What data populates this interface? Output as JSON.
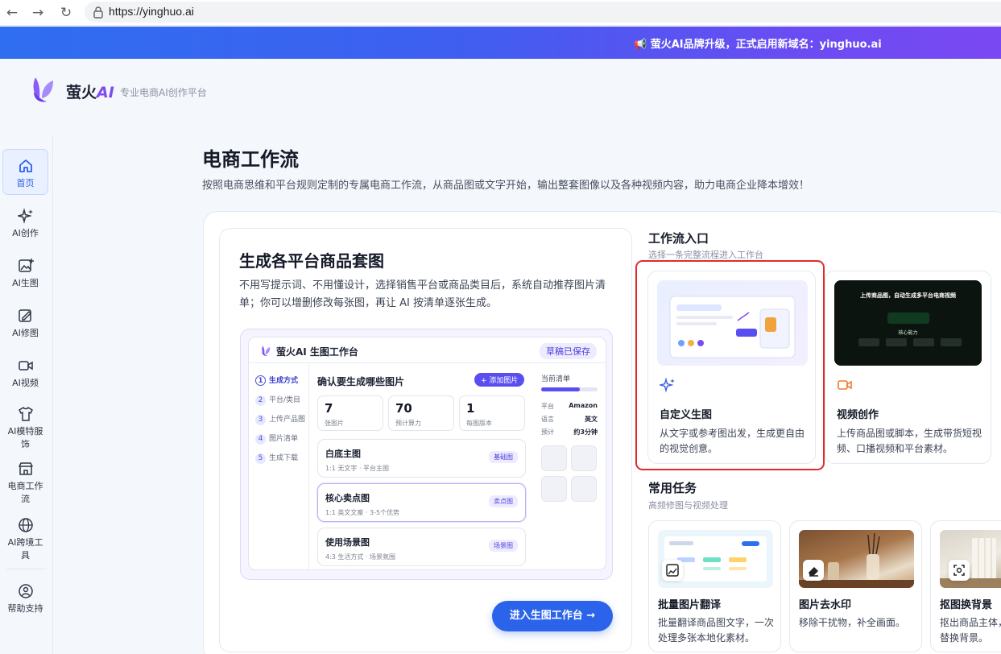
{
  "browser": {
    "url": "https://yinghuo.ai"
  },
  "banner": {
    "text": "📢 萤火AI品牌升级，正式启用新域名：yinghuo.ai"
  },
  "header": {
    "brand_main": "萤火",
    "brand_ai": "AI",
    "slogan": "专业电商AI创作平台"
  },
  "sidebar": {
    "items": [
      {
        "label": "首页",
        "icon": "home-icon"
      },
      {
        "label": "AI创作",
        "icon": "sparkle-icon"
      },
      {
        "label": "AI生图",
        "icon": "image-plus-icon"
      },
      {
        "label": "AI修图",
        "icon": "image-edit-icon"
      },
      {
        "label": "AI视频",
        "icon": "video-icon"
      },
      {
        "label": "AI模特服饰",
        "icon": "tshirt-icon"
      },
      {
        "label": "电商工作流",
        "icon": "store-icon"
      },
      {
        "label": "AI跨境工具",
        "icon": "globe-icon"
      },
      {
        "label": "帮助支持",
        "icon": "help-icon"
      }
    ]
  },
  "page": {
    "title": "电商工作流",
    "desc": "按照电商思维和平台规则定制的专属电商工作流，从商品图或文字开始，输出整套图像以及各种视频内容，助力电商企业降本增效！"
  },
  "feature": {
    "title": "生成各平台商品套图",
    "desc": "不用写提示词、不用懂设计，选择销售平台或商品类目后，系统自动推荐图片清单；你可以增删修改每张图，再让 AI 按清单逐张生成。",
    "cta": "进入生图工作台 →",
    "workbench": {
      "title": "萤火AI 生图工作台",
      "saved": "草稿已保存",
      "steps": [
        {
          "n": "1",
          "label": "生成方式"
        },
        {
          "n": "2",
          "label": "平台/类目"
        },
        {
          "n": "3",
          "label": "上传产品图"
        },
        {
          "n": "4",
          "label": "图片清单"
        },
        {
          "n": "5",
          "label": "生成下载"
        }
      ],
      "center_title": "确认要生成哪些图片",
      "add_btn": "+ 添加图片",
      "stats": [
        {
          "value": "7",
          "label": "张图片"
        },
        {
          "value": "70",
          "label": "预计算力"
        },
        {
          "value": "1",
          "label": "每图版本"
        }
      ],
      "rows": [
        {
          "title": "白底主图",
          "sub": "1:1 无文字 · 平台主图",
          "tag": "基础图"
        },
        {
          "title": "核心卖点图",
          "sub": "1:1 英文文案 · 3-5个优势",
          "tag": "卖点图"
        },
        {
          "title": "使用场景图",
          "sub": "4:3 生活方式 · 场景氛围",
          "tag": "场景图"
        }
      ],
      "list_title": "当前清单",
      "progress": 0.68,
      "kv": [
        {
          "k": "平台",
          "v": "Amazon"
        },
        {
          "k": "语言",
          "v": "英文"
        },
        {
          "k": "预计",
          "v": "约3分钟"
        }
      ]
    }
  },
  "workflow": {
    "title": "工作流入口",
    "sub": "选择一条完整流程进入工作台",
    "cards": [
      {
        "title": "自定义生图",
        "desc": "从文字或参考图出发，生成更自由的视觉创意。",
        "icon": "sparkle-icon"
      },
      {
        "title": "视频创作",
        "desc": "上传商品图或脚本，生成带货短视频、口播视频和平台素材。",
        "icon": "video-icon",
        "preview_text": "上传商品图，自动生成多平台电商视频",
        "preview_label": "核心能力"
      }
    ]
  },
  "tasks": {
    "title": "常用任务",
    "sub": "高频修图与视频处理",
    "cards": [
      {
        "title": "批量图片翻译",
        "desc": "批量翻译商品图文字，一次处理多张本地化素材。",
        "icon": "image-icon"
      },
      {
        "title": "图片去水印",
        "desc": "移除干扰物，补全画面。",
        "icon": "eraser-icon"
      },
      {
        "title": "抠图换背景",
        "desc": "抠出商品主体，替换背景。",
        "icon": "focus-icon"
      }
    ]
  },
  "colors": {
    "accent": "#2b63ea",
    "purple": "#5b4ef0",
    "highlight": "#e02b2b"
  }
}
